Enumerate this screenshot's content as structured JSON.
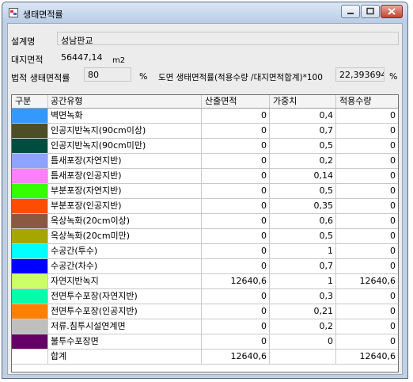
{
  "window": {
    "title": "생태면적률"
  },
  "form": {
    "design_label": "설계명",
    "design_value": "성남판교",
    "site_area_label": "대지면적",
    "site_area_value": "56447,14",
    "site_area_unit": "m2",
    "legal_ratio_label": "법적 생태면적률",
    "legal_ratio_value": "80",
    "percent_sign": "%",
    "plan_ratio_label": "도면 생태면적률(적용수량 /대지면적합계)*100",
    "plan_ratio_value": "22,393694348",
    "percent_sign2": "%"
  },
  "table": {
    "headers": [
      "구분",
      "공간유형",
      "산출면적",
      "가중치",
      "적용수량"
    ],
    "rows": [
      {
        "color": "#3399ff",
        "type": "벽면녹화",
        "area": "0",
        "weight": "0,4",
        "applied": "0"
      },
      {
        "color": "#4d4d26",
        "type": "인공지반녹지(90cm이상)",
        "area": "0",
        "weight": "0,7",
        "applied": "0"
      },
      {
        "color": "#004d40",
        "type": "인공지반녹지(90cm미만)",
        "area": "0",
        "weight": "0,5",
        "applied": "0"
      },
      {
        "color": "#8ea2ff",
        "type": "틈새포장(자연지반)",
        "area": "0",
        "weight": "0,2",
        "applied": "0"
      },
      {
        "color": "#ff80ff",
        "type": "틈새포장(인공지반)",
        "area": "0",
        "weight": "0,14",
        "applied": "0"
      },
      {
        "color": "#33ff00",
        "type": "부분포장(자연지반)",
        "area": "0",
        "weight": "0,5",
        "applied": "0"
      },
      {
        "color": "#ff4d00",
        "type": "부분포장(인공지반)",
        "area": "0",
        "weight": "0,35",
        "applied": "0"
      },
      {
        "color": "#8a5a40",
        "type": "옥상녹화(20cm이상)",
        "area": "0",
        "weight": "0,6",
        "applied": "0"
      },
      {
        "color": "#a6a600",
        "type": "옥상녹화(20cm미만)",
        "area": "0",
        "weight": "0,5",
        "applied": "0"
      },
      {
        "color": "#00ffff",
        "type": "수공간(투수)",
        "area": "0",
        "weight": "1",
        "applied": "0"
      },
      {
        "color": "#0000ff",
        "type": "수공간(차수)",
        "area": "0",
        "weight": "0,7",
        "applied": "0"
      },
      {
        "color": "#ccff66",
        "type": "자연지반녹지",
        "area": "12640,6",
        "weight": "1",
        "applied": "12640,6"
      },
      {
        "color": "#00ffaa",
        "type": "전면투수포장(자연지반)",
        "area": "0",
        "weight": "0,3",
        "applied": "0"
      },
      {
        "color": "#ff8000",
        "type": "전면투수포장(인공지반)",
        "area": "0",
        "weight": "0,21",
        "applied": "0"
      },
      {
        "color": "#bfbfbf",
        "type": "저류.침투시설연계면",
        "area": "0",
        "weight": "0,2",
        "applied": "0"
      },
      {
        "color": "#660066",
        "type": "불투수포장면",
        "area": "0",
        "weight": "0",
        "applied": "0"
      },
      {
        "color": "#ffffff",
        "type": "합계",
        "area": "12640,6",
        "weight": "",
        "applied": "12640,6"
      }
    ]
  }
}
